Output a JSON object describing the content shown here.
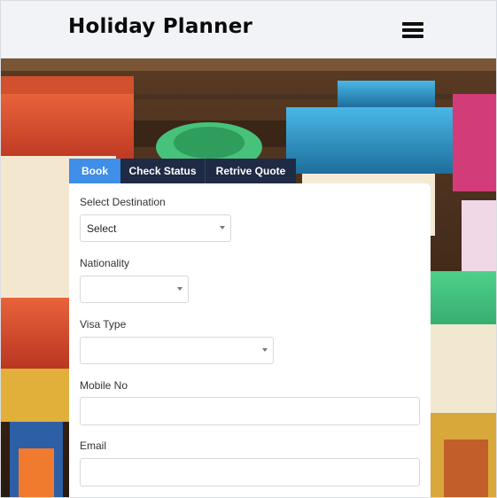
{
  "app": {
    "title": "Holiday Planner"
  },
  "header": {
    "menu_icon": "hamburger-menu-icon"
  },
  "tabs": [
    {
      "label": "Book",
      "active": true
    },
    {
      "label": "Check Status",
      "active": false
    },
    {
      "label": "Retrive Quote",
      "active": false
    }
  ],
  "form": {
    "destination": {
      "label": "Select Destination",
      "value": "Select"
    },
    "nationality": {
      "label": "Nationality",
      "value": ""
    },
    "visa_type": {
      "label": "Visa Type",
      "value": ""
    },
    "mobile": {
      "label": "Mobile No",
      "value": "",
      "placeholder": ""
    },
    "email": {
      "label": "Email",
      "value": "",
      "placeholder": ""
    }
  },
  "colors": {
    "tab_active": "#3f8ee8",
    "tab_inactive": "#1f2a44",
    "header_bg": "#f2f3f7"
  }
}
